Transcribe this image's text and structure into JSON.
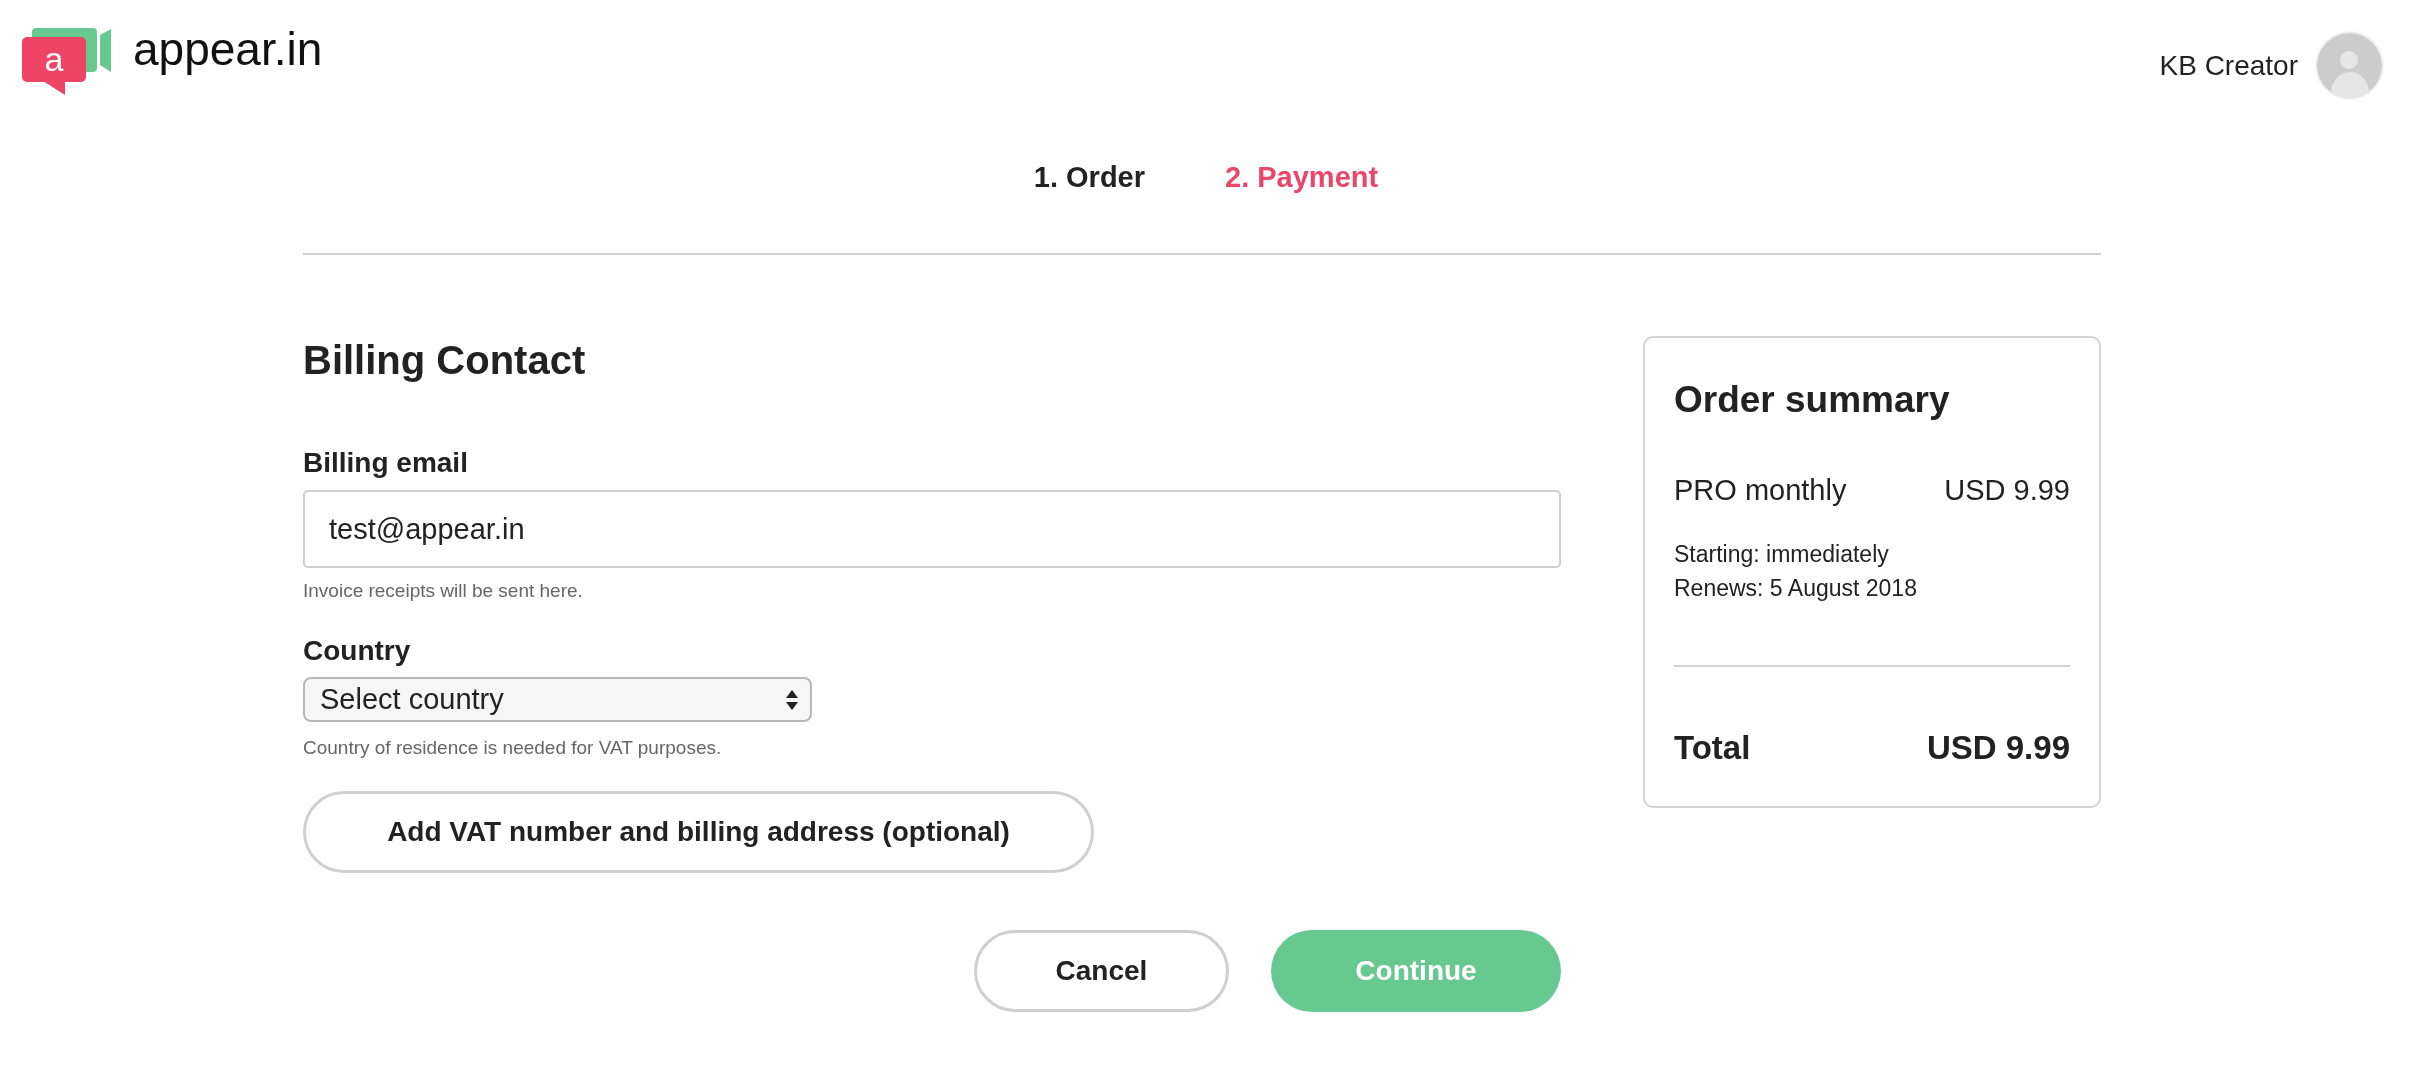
{
  "header": {
    "logo": {
      "letter": "a",
      "wordmark": "appear.in"
    },
    "user": {
      "name": "KB Creator"
    }
  },
  "steps": [
    {
      "label": "1. Order",
      "selected": false
    },
    {
      "label": "2. Payment",
      "selected": true
    }
  ],
  "billing_contact": {
    "title": "Billing Contact",
    "fields": [
      {
        "kind": "text",
        "label": "Billing email",
        "value": "test@appear.in",
        "hint": "Invoice receipts will be sent here."
      },
      {
        "kind": "select",
        "label": "Country",
        "value": "Select country",
        "hint": "Country of residence is needed for VAT purposes."
      }
    ],
    "vat_button": "Add VAT number and billing address (optional)"
  },
  "order_summary": {
    "title": "Order summary",
    "items": [
      {
        "name": "PRO monthly",
        "price": "USD 9.99"
      }
    ],
    "details": [
      "Starting: immediately",
      "Renews: 5 August 2018"
    ],
    "total": {
      "label": "Total",
      "amount": "USD 9.99"
    }
  },
  "actions": [
    {
      "kind": "secondary",
      "label": "Cancel"
    },
    {
      "kind": "primary",
      "label": "Continue"
    }
  ]
}
